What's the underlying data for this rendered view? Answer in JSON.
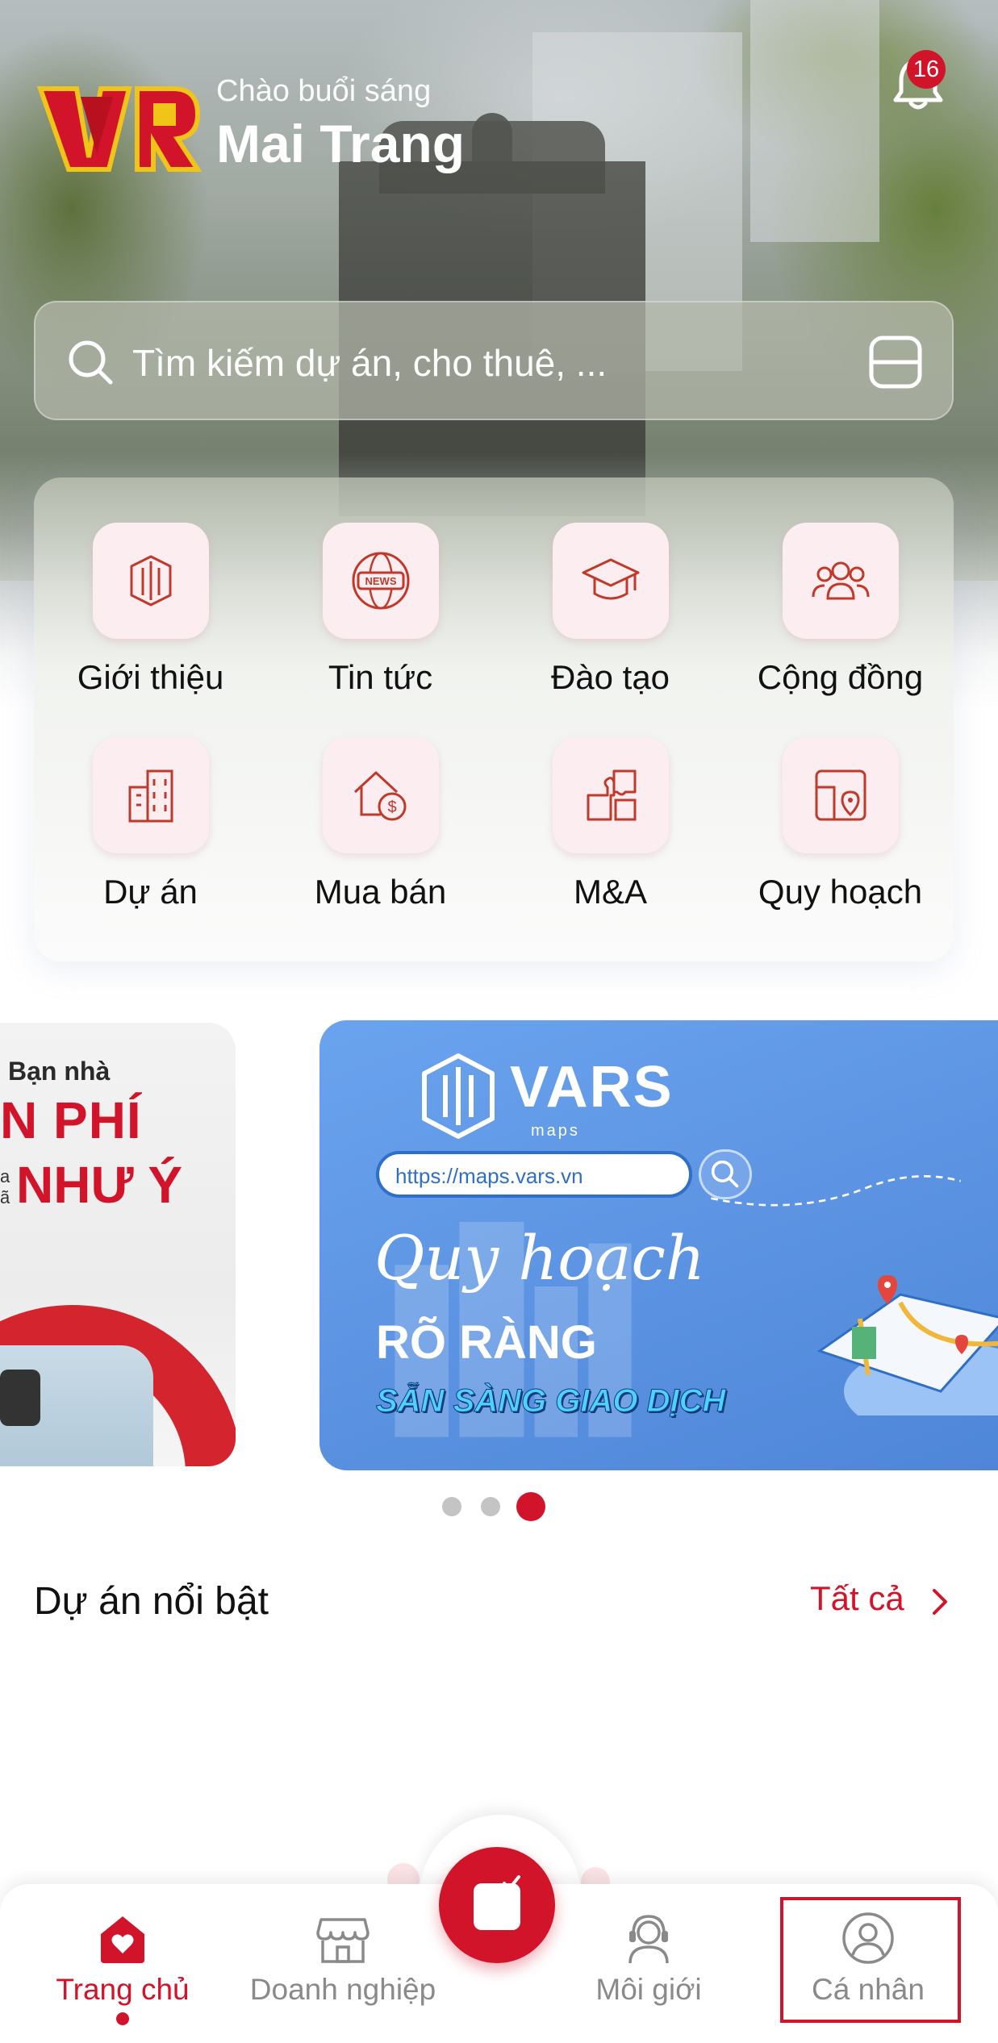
{
  "header": {
    "greeting": "Chào buổi sáng",
    "user_name": "Mai Trang",
    "notification_count": "16"
  },
  "search": {
    "placeholder": "Tìm kiếm dự án, cho thuê, ..."
  },
  "categories": [
    {
      "label": "Giới thiệu",
      "icon": "intro-icon"
    },
    {
      "label": "Tin tức",
      "icon": "news-icon"
    },
    {
      "label": "Đào tạo",
      "icon": "graduation-cap-icon"
    },
    {
      "label": "Cộng đồng",
      "icon": "community-icon"
    },
    {
      "label": "Dự án",
      "icon": "building-icon"
    },
    {
      "label": "Mua bán",
      "icon": "house-dollar-icon"
    },
    {
      "label": "M&A",
      "icon": "puzzle-icon"
    },
    {
      "label": "Quy hoạch",
      "icon": "map-pin-icon"
    }
  ],
  "banners": {
    "left": {
      "small_text": "Bạn nhà",
      "big_line1": "N PHÍ",
      "big_line2": "NHƯ Ý",
      "tiny_text": "a\nã"
    },
    "main": {
      "brand": "VARS",
      "brand_sub": "maps",
      "url": "https://maps.vars.vn",
      "script_text": "Quy hoạch",
      "headline": "RÕ RÀNG",
      "tagline": "SẴN SÀNG GIAO DỊCH"
    },
    "active_index": 2,
    "count": 3
  },
  "featured": {
    "title": "Dự án nổi bật",
    "see_all": "Tất cả"
  },
  "nav": {
    "items": [
      {
        "label": "Trang chủ",
        "icon": "home-heart-icon",
        "active": true
      },
      {
        "label": "Doanh nghiệp",
        "icon": "store-icon",
        "active": false
      },
      {
        "label": "Môi giới",
        "icon": "broker-headset-icon",
        "active": false
      },
      {
        "label": "Cá nhân",
        "icon": "user-icon",
        "active": false
      }
    ],
    "fab_icon": "note-check-icon"
  },
  "colors": {
    "brand_red": "#d2142a",
    "banner_blue": "#5b93e2",
    "tile_pink": "#fceef0"
  }
}
